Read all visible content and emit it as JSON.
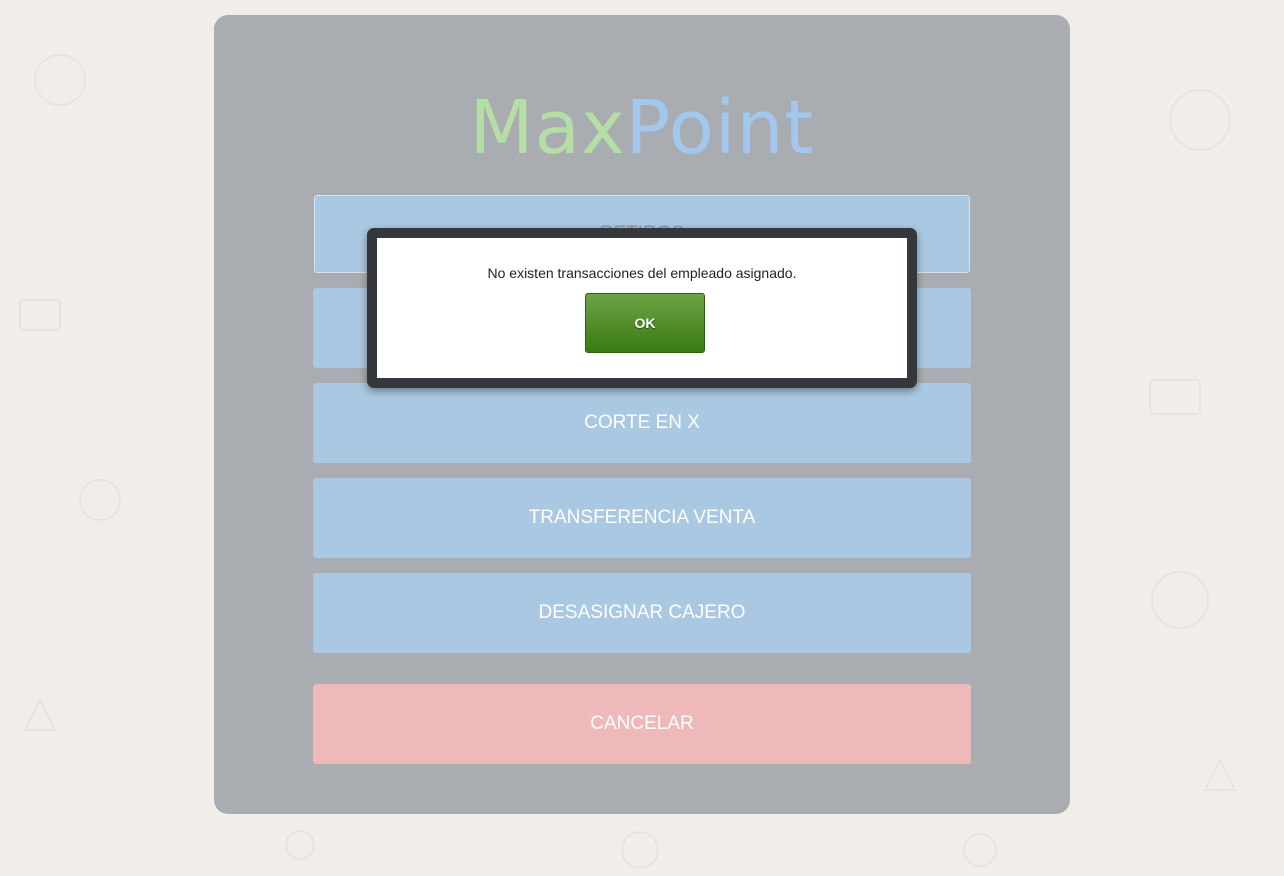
{
  "logo": {
    "part1": "Max",
    "part2": "Point"
  },
  "menu": {
    "items": [
      {
        "label": "RETIROS"
      },
      {
        "label": ""
      },
      {
        "label": "CORTE EN X"
      },
      {
        "label": "TRANSFERENCIA VENTA"
      },
      {
        "label": "DESASIGNAR CAJERO"
      }
    ],
    "cancel_label": "CANCELAR"
  },
  "dialog": {
    "message": "No existen transacciones del empleado asignado.",
    "ok_label": "OK"
  },
  "colors": {
    "panel": "#a9acb1",
    "menu_button": "#abc8e2",
    "cancel_button": "#efb9b9",
    "ok_button": "#4e8a28",
    "logo_max": "#b4dea6",
    "logo_point": "#a3c8ee"
  }
}
